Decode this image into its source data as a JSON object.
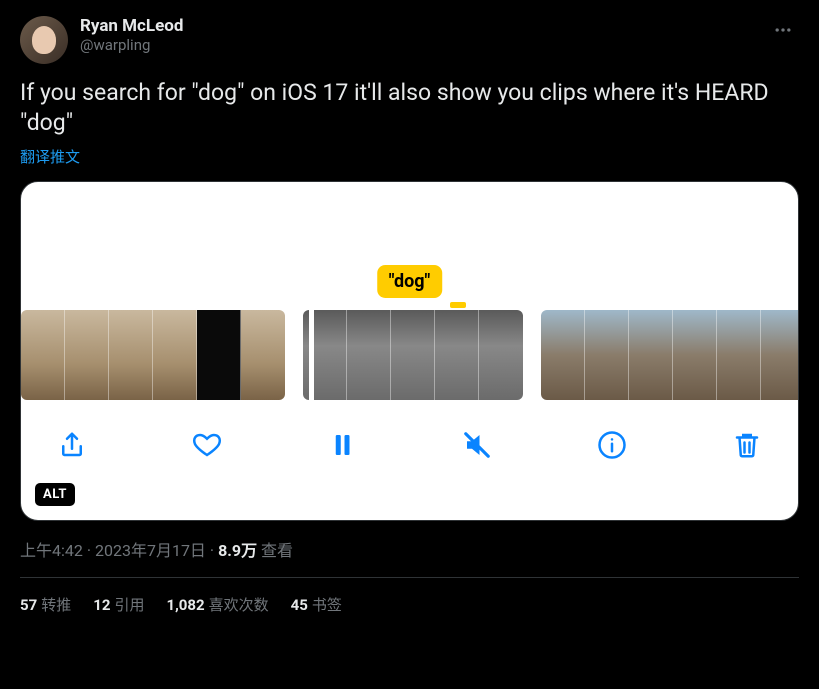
{
  "tweet": {
    "author": {
      "display_name": "Ryan McLeod",
      "handle": "@warpling"
    },
    "body": "If you search for \"dog\" on iOS 17 it'll also show you clips where it's HEARD \"dog\"",
    "translate_label": "翻译推文",
    "media": {
      "highlight_label": "\"dog\"",
      "alt_badge": "ALT",
      "toolbar": {
        "share": "share",
        "like": "like",
        "pause": "pause",
        "mute": "mute",
        "info": "info",
        "delete": "delete"
      }
    },
    "meta": {
      "time": "上午4:42",
      "sep1": " · ",
      "date": "2023年7月17日",
      "sep2": " · ",
      "views_count": "8.9万",
      "views_label": " 查看"
    },
    "stats": {
      "retweets": {
        "count": "57",
        "label": "转推"
      },
      "quotes": {
        "count": "12",
        "label": "引用"
      },
      "likes": {
        "count": "1,082",
        "label": "喜欢次数"
      },
      "bookmarks": {
        "count": "45",
        "label": "书签"
      }
    }
  }
}
